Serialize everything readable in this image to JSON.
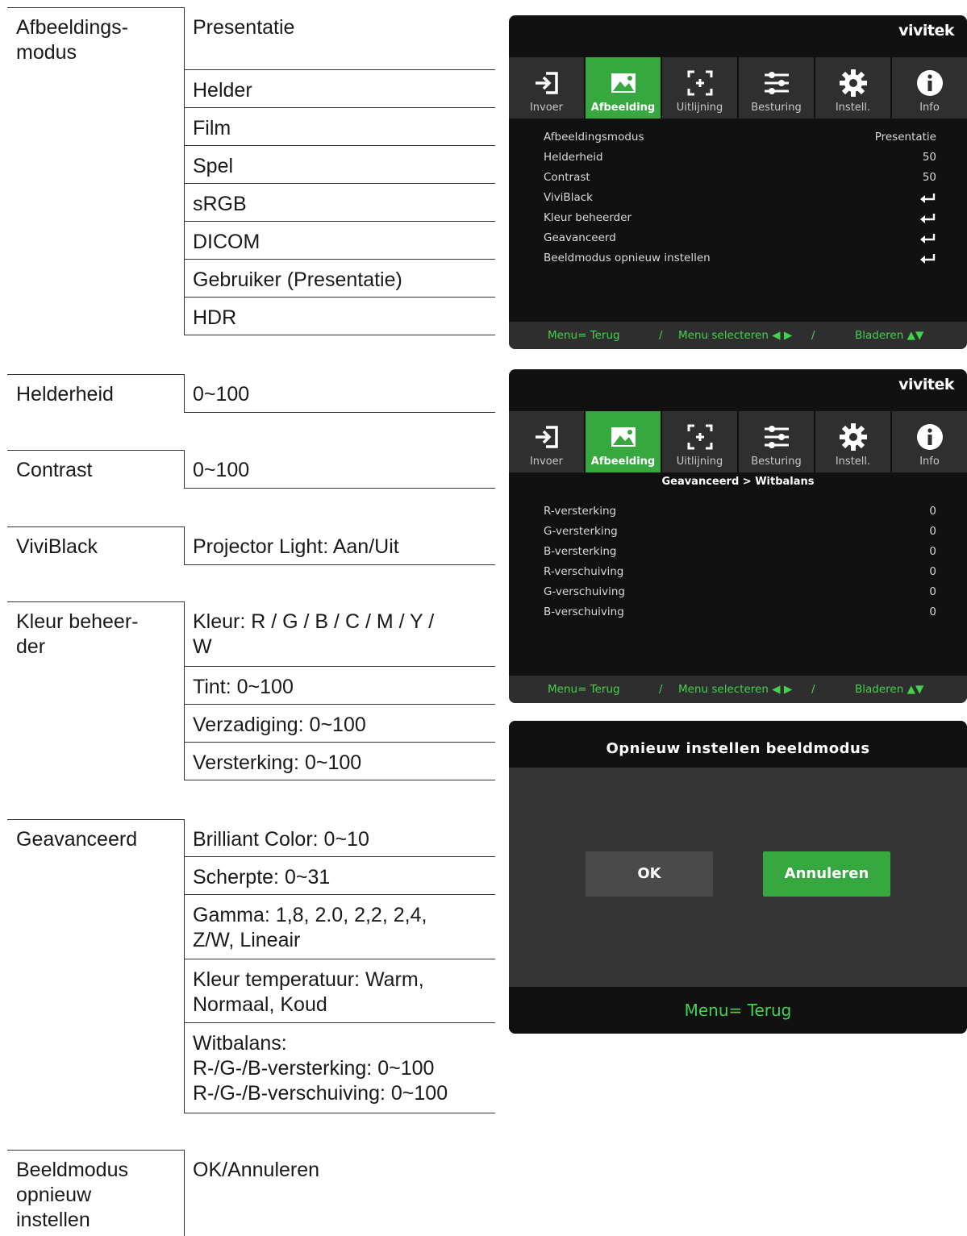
{
  "doc": {
    "groups": [
      {
        "label": "Afbeeldings-\nmodus",
        "options": [
          "Presentatie",
          "Helder",
          "Film",
          "Spel",
          "sRGB",
          "DICOM",
          "Gebruiker (Presentatie)",
          "HDR"
        ]
      },
      {
        "label": "Helderheid",
        "options": [
          "0~100"
        ]
      },
      {
        "label": "Contrast",
        "options": [
          "0~100"
        ]
      },
      {
        "label": "ViviBlack",
        "options": [
          "Projector Light: Aan/Uit"
        ]
      },
      {
        "label": "Kleur beheer-\nder",
        "options": [
          "Kleur: R / G / B / C / M / Y /\nW",
          "Tint: 0~100",
          "Verzadiging: 0~100",
          "Versterking: 0~100"
        ]
      },
      {
        "label": "Geavanceerd",
        "options": [
          "Brilliant Color: 0~10",
          "Scherpte: 0~31",
          "Gamma: 1,8, 2.0, 2,2, 2,4,\nZ/W, Lineair",
          "Kleur temperatuur: Warm,\nNormaal, Koud",
          "Witbalans:\nR-/G-/B-versterking: 0~100\nR-/G-/B-verschuiving: 0~100"
        ]
      },
      {
        "label": "Beeldmodus\nopnieuw\ninstellen",
        "options": [
          "OK/Annuleren"
        ]
      }
    ]
  },
  "osd": {
    "logo": "vivitek",
    "accent_color": "#36a83f",
    "footer_text_color": "#44d24e",
    "tabs": [
      {
        "label": "Invoer",
        "icon": "input-icon"
      },
      {
        "label": "Afbeelding",
        "icon": "image-icon",
        "active": true
      },
      {
        "label": "Uitlijning",
        "icon": "alignment-icon"
      },
      {
        "label": "Besturing",
        "icon": "control-sliders-icon"
      },
      {
        "label": "Instell.",
        "icon": "gear-icon"
      },
      {
        "label": "Info",
        "icon": "info-icon"
      }
    ],
    "footer": {
      "back": "Menu= Terug",
      "sep": "/",
      "select": "Menu selecteren ◀ ▶",
      "browse": "Bladeren ▲▼"
    },
    "screen1": {
      "rows": [
        {
          "label": "Afbeeldingsmodus",
          "value": "Presentatie"
        },
        {
          "label": "Helderheid",
          "value": "50"
        },
        {
          "label": "Contrast",
          "value": "50"
        },
        {
          "label": "ViviBlack",
          "value": "",
          "enter": true
        },
        {
          "label": "Kleur beheerder",
          "value": "",
          "enter": true
        },
        {
          "label": "Geavanceerd",
          "value": "",
          "enter": true
        },
        {
          "label": "Beeldmodus opnieuw instellen",
          "value": "",
          "enter": true
        }
      ]
    },
    "screen2": {
      "subtitle": "Geavanceerd > Witbalans",
      "rows": [
        {
          "label": "R-versterking",
          "value": "0"
        },
        {
          "label": "G-versterking",
          "value": "0"
        },
        {
          "label": "B-versterking",
          "value": "0"
        },
        {
          "label": "R-verschuiving",
          "value": "0"
        },
        {
          "label": "G-verschuiving",
          "value": "0"
        },
        {
          "label": "B-verschuiving",
          "value": "0"
        }
      ]
    },
    "dialog": {
      "title": "Opnieuw instellen beeldmodus",
      "ok_label": "OK",
      "cancel_label": "Annuleren",
      "footer": "Menu= Terug"
    }
  }
}
